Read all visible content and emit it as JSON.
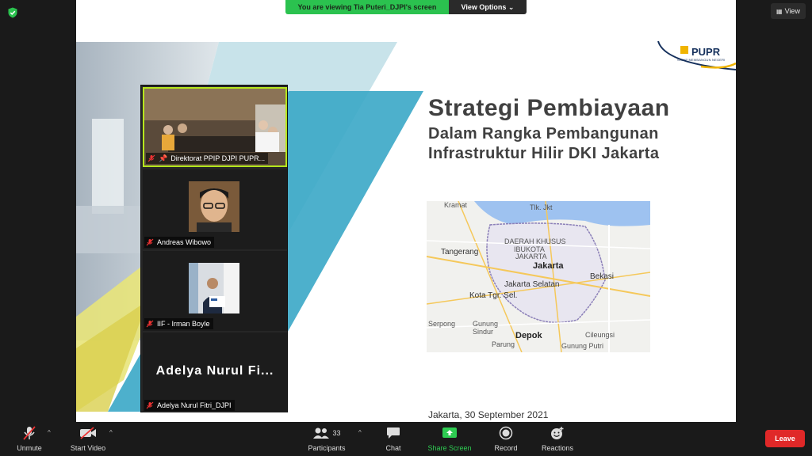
{
  "banner": {
    "viewing_text": "You are viewing Tia Puteri_DJPI's screen",
    "view_options_label": "View Options"
  },
  "view_button": {
    "label": "View"
  },
  "slide": {
    "title": "Strategi Pembiayaan",
    "subtitle_line1": "Dalam Rangka Pembangunan",
    "subtitle_line2": "Infrastruktur Hilir DKI Jakarta",
    "date": "Jakarta, 30 September 2021",
    "logo_text": "PUPR",
    "logo_sub": "SIGAP MEMBANGUN NEGERI",
    "map_labels": [
      {
        "text": "Kramat",
        "cls": ""
      },
      {
        "text": "Tlk. Jkt",
        "cls": ""
      },
      {
        "text": "DAERAH KHUSUS",
        "cls": ""
      },
      {
        "text": "IBUKOTA",
        "cls": ""
      },
      {
        "text": "JAKARTA",
        "cls": ""
      },
      {
        "text": "Tangerang",
        "cls": "mid"
      },
      {
        "text": "Jakarta",
        "cls": "big"
      },
      {
        "text": "Bekasi",
        "cls": "mid"
      },
      {
        "text": "Jakarta Selatan",
        "cls": "mid"
      },
      {
        "text": "Kota Tgr. Sel.",
        "cls": "mid"
      },
      {
        "text": "Serpong",
        "cls": ""
      },
      {
        "text": "Gunung",
        "cls": ""
      },
      {
        "text": "Sindur",
        "cls": ""
      },
      {
        "text": "Depok",
        "cls": "big"
      },
      {
        "text": "Cileungsi",
        "cls": ""
      },
      {
        "text": "Parung",
        "cls": ""
      },
      {
        "text": "Gunung Putri",
        "cls": ""
      }
    ]
  },
  "participants": [
    {
      "name": "Direktorat PPIP DJPI PUPR..."
    },
    {
      "name": "Andreas Wibowo"
    },
    {
      "name": "IIF - Irman Boyle"
    },
    {
      "name": "Adelya Nurul Fitri_DJPI",
      "display": "Adelya Nurul Fi..."
    }
  ],
  "toolbar": {
    "unmute": "Unmute",
    "start_video": "Start Video",
    "participants": "Participants",
    "participant_count": "33",
    "chat": "Chat",
    "share_screen": "Share Screen",
    "record": "Record",
    "reactions": "Reactions",
    "leave": "Leave"
  },
  "colors": {
    "banner_green": "#2bc24f",
    "share_green": "#2ecc52",
    "leave_red": "#e02828",
    "active_speaker": "#b5e61d"
  }
}
